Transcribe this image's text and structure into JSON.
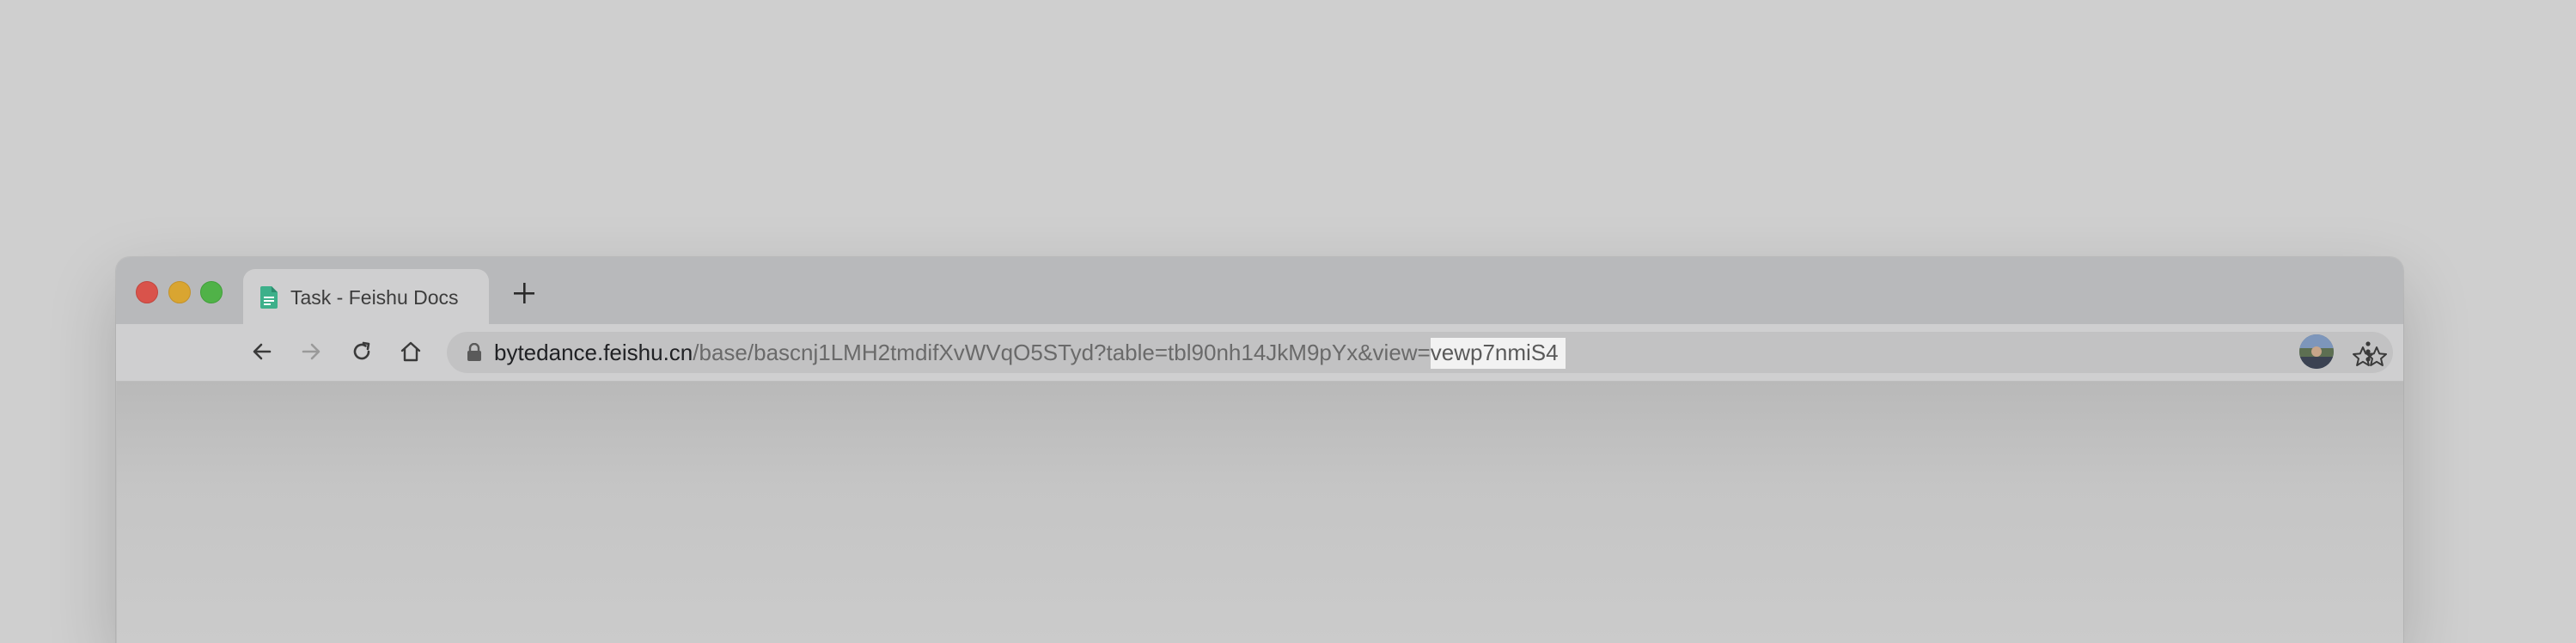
{
  "tab": {
    "title": "Task - Feishu Docs",
    "favicon": "document-icon"
  },
  "new_tab_label": "+",
  "toolbar": {
    "back": "back-arrow-icon",
    "forward": "forward-arrow-icon",
    "reload": "reload-icon",
    "home": "home-icon"
  },
  "address": {
    "host": "bytedance.feishu.cn",
    "path": "/base/bascnj1LMH2tmdifXvWVqO5STyd?table=tbl90nh14JkM9pYx&view=",
    "selected": "vewp7nmiS4"
  },
  "colors": {
    "close": "#d9534b",
    "minimize": "#d9a531",
    "maximize": "#50b248",
    "favicon": "#3db08a"
  }
}
